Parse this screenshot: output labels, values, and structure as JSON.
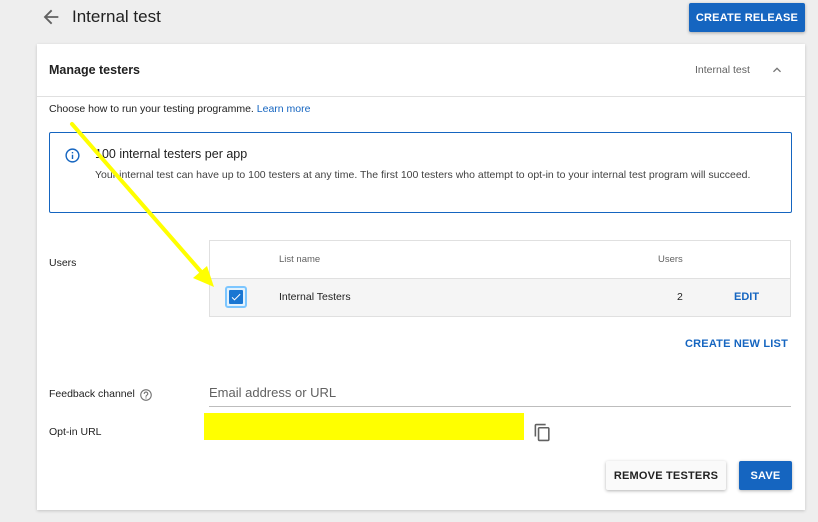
{
  "header": {
    "back_icon": "arrow-back-icon",
    "title": "Internal test",
    "create_release_label": "CREATE RELEASE"
  },
  "manage_testers": {
    "title": "Manage testers",
    "subtitle": "Internal test",
    "collapse_icon": "chevron-up-icon",
    "intro_text": "Choose how to run your testing programme.",
    "learn_more_label": "Learn more"
  },
  "info_box": {
    "icon": "info-icon",
    "title": "100 internal testers per app",
    "body": "Your internal test can have up to 100 testers at any time. The first 100 testers who attempt to opt-in to your internal test program will succeed."
  },
  "users": {
    "label": "Users",
    "columns": [
      "List name",
      "Users"
    ],
    "rows": [
      {
        "checked": true,
        "name": "Internal Testers",
        "count": "2",
        "action": "EDIT"
      }
    ],
    "create_new_list_label": "CREATE NEW LIST"
  },
  "feedback": {
    "label": "Feedback channel",
    "help_icon": "help-circle-icon",
    "value": "",
    "placeholder": "Email address or URL"
  },
  "opt_in": {
    "label": "Opt-in URL",
    "value": "",
    "copy_icon": "copy-icon"
  },
  "actions": {
    "remove_label": "REMOVE TESTERS",
    "save_label": "SAVE"
  },
  "colors": {
    "primary": "#1565c0",
    "redaction": "#ffff00",
    "annotation_arrow": "#ffff00"
  }
}
